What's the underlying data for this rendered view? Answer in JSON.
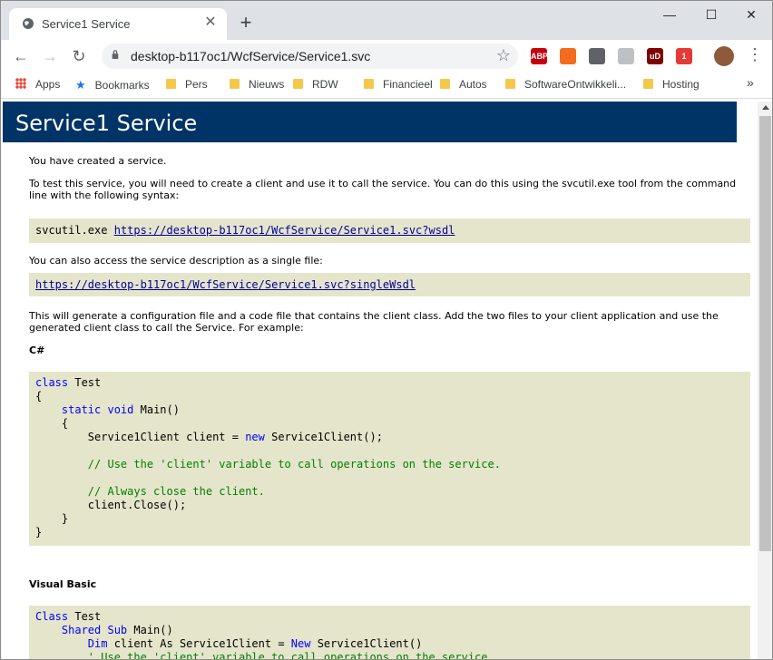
{
  "browser": {
    "tab_title": "Service1 Service",
    "tab_close": "✕",
    "new_tab": "+",
    "url": "desktop-b117oc1/WcfService/Service1.svc",
    "window_controls": {
      "minimize": "—",
      "maximize": "☐",
      "close": "✕"
    },
    "extensions": [
      {
        "name": "abp",
        "label": "ABP",
        "color": "#c7000b"
      },
      {
        "name": "ext2",
        "label": "",
        "color": "#f46b1e"
      },
      {
        "name": "ext3",
        "label": "",
        "color": "#5f6368"
      },
      {
        "name": "ext4",
        "label": "",
        "color": "#bdc1c6"
      },
      {
        "name": "ublock",
        "label": "uD",
        "color": "#800000"
      },
      {
        "name": "ext6",
        "label": "1",
        "color": "#e53935"
      }
    ]
  },
  "bookmarks": [
    {
      "label": "Apps",
      "icon": "apps-icon"
    },
    {
      "label": "Bookmarks",
      "icon": "star-icon"
    },
    {
      "label": "Pers",
      "icon": "folder-icon"
    },
    {
      "label": "Nieuws",
      "icon": "folder-icon"
    },
    {
      "label": "RDW",
      "icon": "folder-icon"
    },
    {
      "label": "Financieel",
      "icon": "folder-icon"
    },
    {
      "label": "Autos",
      "icon": "folder-icon"
    },
    {
      "label": "SoftwareOntwikkeli...",
      "icon": "folder-icon"
    },
    {
      "label": "Hosting",
      "icon": "folder-icon"
    }
  ],
  "bookmarks_overflow": "»",
  "page": {
    "heading": "Service1 Service",
    "intro": "You have created a service.",
    "instructions": "To test this service, you will need to create a client and use it to call the service. You can do this using the svcutil.exe tool from the command line with the following syntax:",
    "svcutil_cmd": "svcutil.exe",
    "wsdl_url": "https://desktop-b117oc1/WcfService/Service1.svc?wsdl",
    "single_file_text": "You can also access the service description as a single file:",
    "single_wsdl_url": "https://desktop-b117oc1/WcfService/Service1.svc?singleWsdl",
    "generate_text": "This will generate a configuration file and a code file that contains the client class. Add the two files to your client application and use the generated client class to call the Service. For example:",
    "csharp_label": "C#",
    "vb_label": "Visual Basic"
  },
  "colors": {
    "heading_bg": "#003366",
    "code_bg": "#e5e5cc",
    "keyword": "#0000ff",
    "comment": "#008000"
  }
}
